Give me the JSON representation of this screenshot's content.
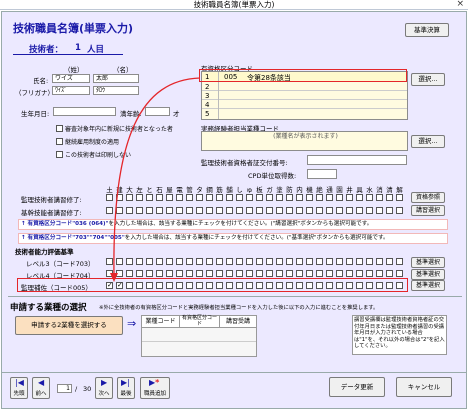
{
  "window": {
    "title": "技術職員名簿(単票入力)",
    "close": "×"
  },
  "header": {
    "title": "技術職員名簿(単票入力)",
    "kijun_button": "基準決算",
    "count_label": "技術者：",
    "count_value": "1",
    "count_unit": "人目"
  },
  "person": {
    "sei_header": "（姓）",
    "mei_header": "（名）",
    "name_label": "氏名:",
    "sei": "ワイズ",
    "mei": "太郎",
    "kana_label": "（フリガナ）:",
    "sei_kana": "ﾜｲｽﾞ",
    "mei_kana": "ﾀﾛｳ",
    "birth_label": "生年月日:",
    "birth_value": "",
    "age_label": "満年齢:",
    "age_value": "",
    "age_unit": "才",
    "checks": [
      "審査対象年内に新規に技術者となった者",
      "継続雇用制度の適用",
      "この技術者は印刷しない"
    ]
  },
  "shikaku": {
    "title": "有資格区分コード",
    "rows": [
      {
        "no": "1",
        "code": "005",
        "name": "令第28条該当"
      },
      {
        "no": "2",
        "code": "",
        "name": ""
      },
      {
        "no": "3",
        "code": "",
        "name": ""
      },
      {
        "no": "4",
        "code": "",
        "name": ""
      },
      {
        "no": "5",
        "code": "",
        "name": ""
      }
    ],
    "select_button": "選択..."
  },
  "jitsumu": {
    "title": "実務経験者担当業種コード",
    "placeholder": "(業種名が表示されます)",
    "select_button": "選択...",
    "kantoku_label": "監理技術者資格者証交付番号:",
    "cpd_label": "CPD単位取得数:"
  },
  "industries": [
    "土",
    "建",
    "大",
    "左",
    "と",
    "石",
    "屋",
    "電",
    "管",
    "タ",
    "鋼",
    "筋",
    "舗",
    "し",
    "ゅ",
    "板",
    "ガ",
    "塗",
    "防",
    "内",
    "機",
    "絶",
    "通",
    "園",
    "井",
    "具",
    "水",
    "消",
    "清",
    "解"
  ],
  "industry_rows": [
    {
      "label": "監理技術者講習修了:",
      "button": "資格参照"
    },
    {
      "label": "基幹技能者講習修了:",
      "button": "講習選択"
    }
  ],
  "notes": [
    {
      "prefix": "↑",
      "code": "有資格区分コード\"036 (064)\"",
      "text": "を入力した場合は、該当する業種にチェックを付けてください。(\"講習選択\"ボタンからも選択可能です。"
    },
    {
      "prefix": "↑",
      "code": "有資格区分コード\"703\"\"704\"\"005\"",
      "text": "を入力した場合は、該当する業種にチェックを付けてください。(\"基準選択\"ボタンからも選択可能です。"
    }
  ],
  "levels": {
    "title": "技術者能力評価基準",
    "rows": [
      {
        "label": "レベル3（コード703）",
        "button": "基準選択"
      },
      {
        "label": "レベル4（コード704）",
        "button": "基準選択"
      },
      {
        "label": "監理補佐（コード005）",
        "button": "基準選択"
      }
    ]
  },
  "shinsei": {
    "title": "申請する業種の選択",
    "note": "※外に全技術者の有資格区分コードと実務経験者担当業種コードを入力した後に以下の入力に進むことを推奨します。",
    "select_button": "申請する2業種を選択する",
    "arrow": "⇒",
    "cols": [
      "業種コード",
      "有資格区分コード",
      "講習受講"
    ],
    "info": "講習受講欄は監理技術者資格者証の交付年月日または監理技術者講習の受講年月日が入力されている場合は\"1\"を、それ以外の場合は\"2\"を記入してください。"
  },
  "footer": {
    "nav": [
      "先頭",
      "前へ",
      "次へ",
      "最後",
      "職員追加"
    ],
    "page_current": "1",
    "page_sep": "/",
    "page_total": "30",
    "update_button": "データ更新",
    "cancel_button": "キャンセル"
  },
  "colors": {
    "accent": "#1a1aa8",
    "highlight": "#e4262a",
    "panel": "#ece9ff",
    "row1": "#fff9cc"
  }
}
